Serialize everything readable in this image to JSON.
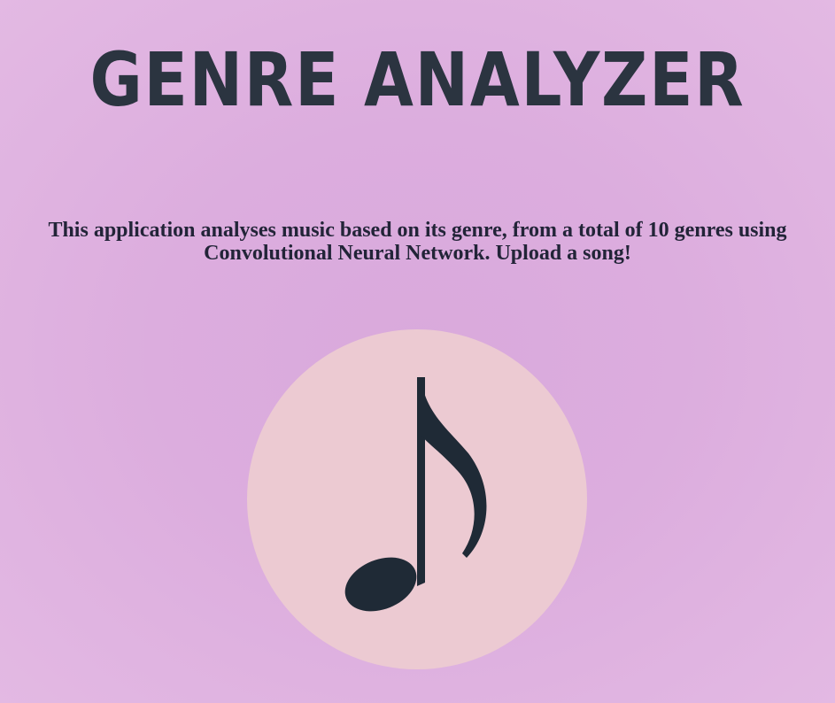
{
  "header": {
    "title": "GENRE ANALYZER"
  },
  "main": {
    "description": "This application analyses music based on its genre, from a total of 10 genres using Convolutional Neural Network. Upload a song!",
    "upload_icon": "music-note-icon"
  },
  "colors": {
    "background": "#dcadde",
    "title": "#2b3440",
    "text": "#222438",
    "circle": "#eccad2",
    "note": "#1f2a36"
  }
}
